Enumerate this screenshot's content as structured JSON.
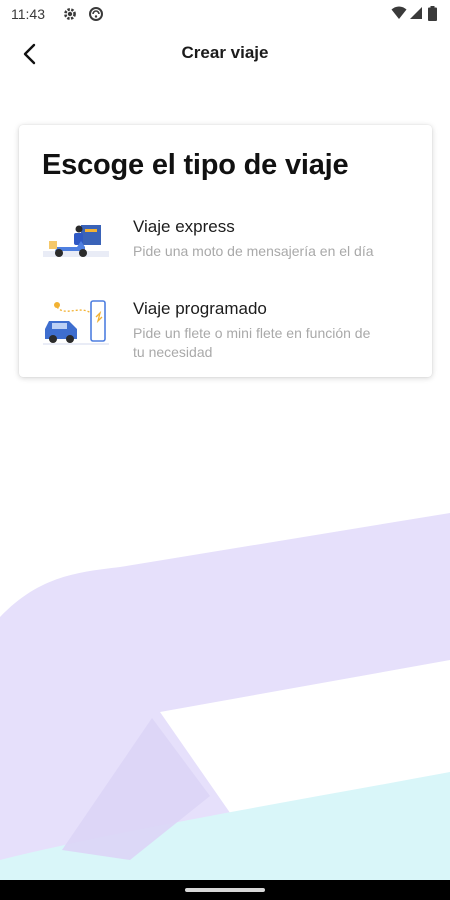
{
  "status_bar": {
    "time": "11:43",
    "left_icons": [
      "gear-icon",
      "sync-icon"
    ],
    "right_icons": [
      "wifi-icon",
      "cell-signal-icon",
      "battery-icon"
    ]
  },
  "app_bar": {
    "back_icon": "back-arrow-icon",
    "title": "Crear viaje"
  },
  "card": {
    "title": "Escoge el tipo de viaje",
    "options": [
      {
        "title": "Viaje express",
        "description": "Pide una moto de mensajería en el día",
        "illustration": "courier-moto-illustration"
      },
      {
        "title": "Viaje programado",
        "description": "Pide un flete o mini flete en función de tu necesidad",
        "illustration": "scheduled-car-route-illustration"
      }
    ]
  },
  "colors": {
    "background_lavender": "#e6e0fb",
    "background_cyan": "#d9f6f9",
    "title_text": "#111111",
    "description_text": "#a9a9a9",
    "navigation_bar": "#000000"
  }
}
